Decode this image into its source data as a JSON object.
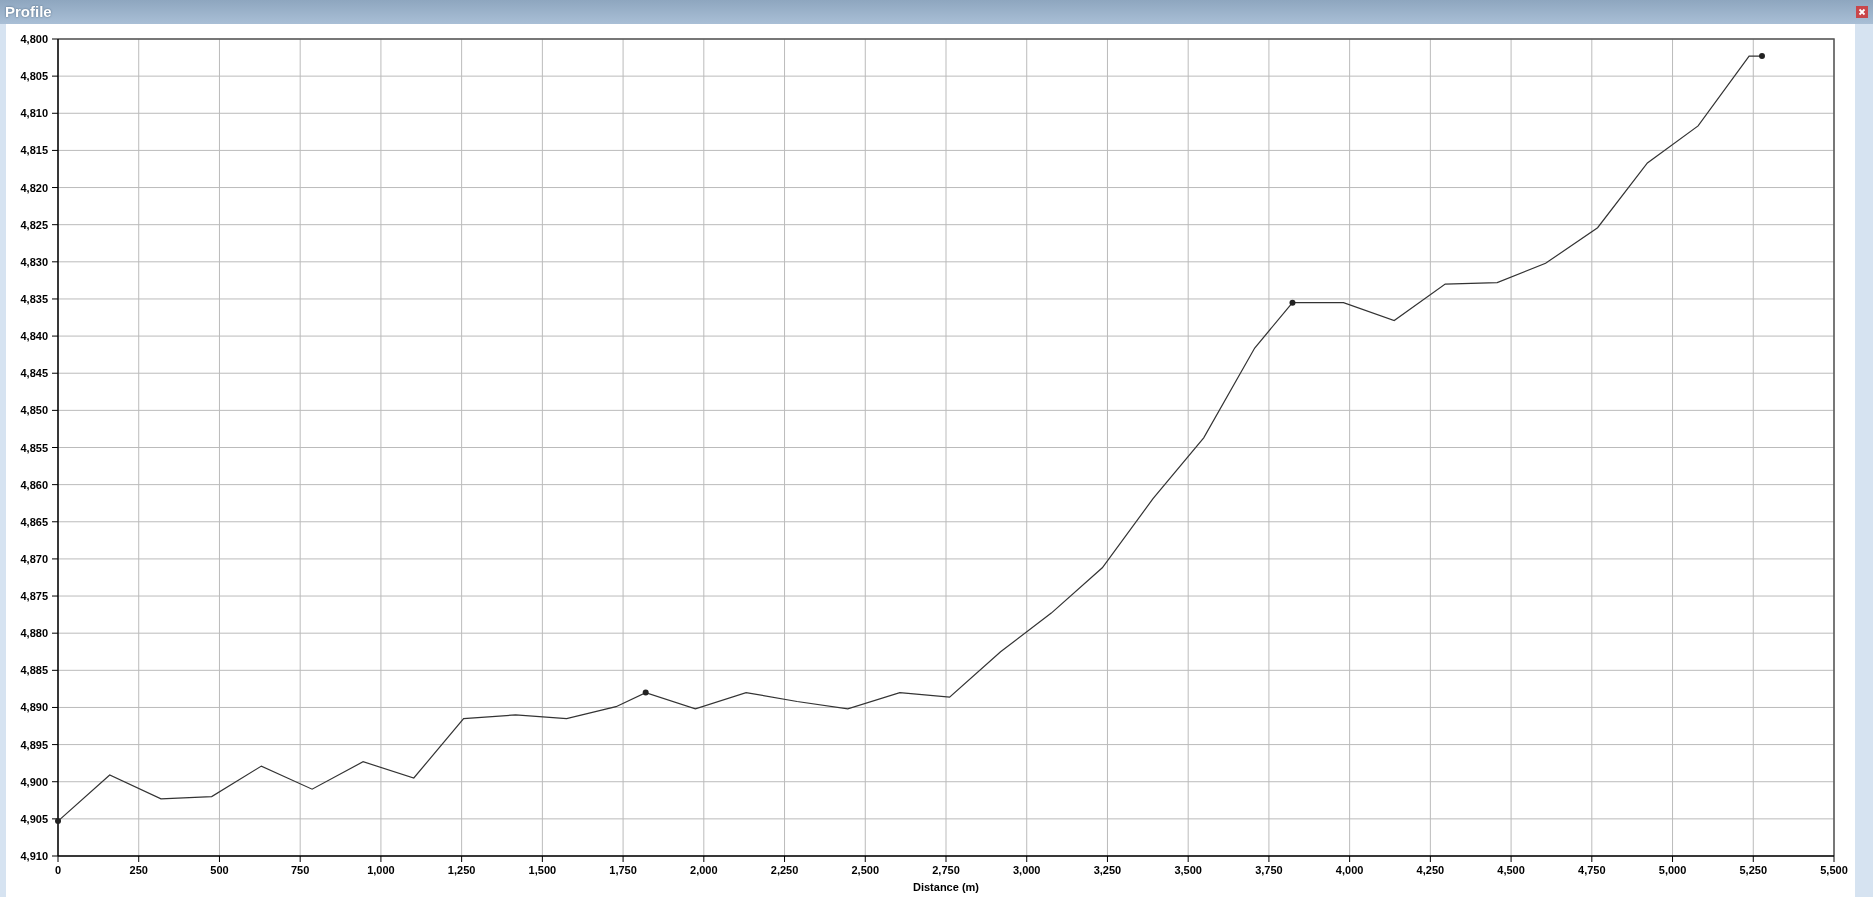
{
  "window": {
    "title": "Profile"
  },
  "chart_data": {
    "type": "line",
    "xlabel": "Distance (m)",
    "xlim": [
      0,
      5500
    ],
    "ylim": [
      4910,
      4800
    ],
    "xticks": [
      {
        "value": 0,
        "label": "0"
      },
      {
        "value": 250,
        "label": "250"
      },
      {
        "value": 500,
        "label": "500"
      },
      {
        "value": 750,
        "label": "750"
      },
      {
        "value": 1000,
        "label": "1,000"
      },
      {
        "value": 1250,
        "label": "1,250"
      },
      {
        "value": 1500,
        "label": "1,500"
      },
      {
        "value": 1750,
        "label": "1,750"
      },
      {
        "value": 2000,
        "label": "2,000"
      },
      {
        "value": 2250,
        "label": "2,250"
      },
      {
        "value": 2500,
        "label": "2,500"
      },
      {
        "value": 2750,
        "label": "2,750"
      },
      {
        "value": 3000,
        "label": "3,000"
      },
      {
        "value": 3250,
        "label": "3,250"
      },
      {
        "value": 3500,
        "label": "3,500"
      },
      {
        "value": 3750,
        "label": "3,750"
      },
      {
        "value": 4000,
        "label": "4,000"
      },
      {
        "value": 4250,
        "label": "4,250"
      },
      {
        "value": 4500,
        "label": "4,500"
      },
      {
        "value": 4750,
        "label": "4,750"
      },
      {
        "value": 5000,
        "label": "5,000"
      },
      {
        "value": 5250,
        "label": "5,250"
      },
      {
        "value": 5500,
        "label": "5,500"
      }
    ],
    "yticks": [
      {
        "value": 4800,
        "label": "4,800"
      },
      {
        "value": 4805,
        "label": "4,805"
      },
      {
        "value": 4810,
        "label": "4,810"
      },
      {
        "value": 4815,
        "label": "4,815"
      },
      {
        "value": 4820,
        "label": "4,820"
      },
      {
        "value": 4825,
        "label": "4,825"
      },
      {
        "value": 4830,
        "label": "4,830"
      },
      {
        "value": 4835,
        "label": "4,835"
      },
      {
        "value": 4840,
        "label": "4,840"
      },
      {
        "value": 4845,
        "label": "4,845"
      },
      {
        "value": 4850,
        "label": "4,850"
      },
      {
        "value": 4855,
        "label": "4,855"
      },
      {
        "value": 4860,
        "label": "4,860"
      },
      {
        "value": 4865,
        "label": "4,865"
      },
      {
        "value": 4870,
        "label": "4,870"
      },
      {
        "value": 4875,
        "label": "4,875"
      },
      {
        "value": 4880,
        "label": "4,880"
      },
      {
        "value": 4885,
        "label": "4,885"
      },
      {
        "value": 4890,
        "label": "4,890"
      },
      {
        "value": 4895,
        "label": "4,895"
      },
      {
        "value": 4900,
        "label": "4,900"
      },
      {
        "value": 4905,
        "label": "4,905"
      },
      {
        "value": 4910,
        "label": "4,910"
      }
    ],
    "grid": true,
    "x": [
      0,
      160,
      319,
      476,
      630,
      787,
      945,
      1102,
      1256,
      1417,
      1575,
      1728,
      1820,
      1974,
      2131,
      2289,
      2446,
      2607,
      2761,
      2919,
      3076,
      3234,
      3391,
      3548,
      3706,
      3823,
      3981,
      4138,
      4296,
      4457,
      4607,
      4768,
      4922,
      5079,
      5237,
      5277
    ],
    "series": [
      {
        "color": "#333333",
        "values": [
          4905.3,
          4899.1,
          4902.3,
          4902.0,
          4897.9,
          4901.0,
          4897.3,
          4899.5,
          4891.5,
          4891.0,
          4891.5,
          4889.9,
          4888.0,
          4890.2,
          4888.0,
          4889.2,
          4890.2,
          4888.0,
          4888.6,
          4882.5,
          4877.3,
          4871.2,
          4861.9,
          4853.7,
          4841.6,
          4835.5,
          4835.5,
          4837.9,
          4833.0,
          4832.8,
          4830.2,
          4825.4,
          4816.7,
          4811.7,
          4802.3,
          4802.3
        ]
      },
      {
        "color": "#222222",
        "marker": "circle",
        "values": [
          4905.3,
          null,
          null,
          null,
          null,
          null,
          null,
          null,
          null,
          null,
          null,
          null,
          null,
          null,
          null,
          null,
          null,
          null,
          null,
          null,
          null,
          null,
          null,
          null,
          null,
          null,
          null,
          null,
          null,
          null,
          null,
          null,
          null,
          null,
          null,
          null
        ]
      },
      {
        "color": "#222222",
        "marker": "circle",
        "values": [
          null,
          null,
          null,
          null,
          null,
          null,
          null,
          null,
          null,
          null,
          null,
          null,
          4888.0,
          null,
          null,
          null,
          null,
          null,
          null,
          null,
          null,
          null,
          null,
          null,
          null,
          null,
          null,
          null,
          null,
          null,
          null,
          null,
          null,
          null,
          null,
          null
        ]
      },
      {
        "color": "#222222",
        "marker": "circle",
        "values": [
          null,
          null,
          null,
          null,
          null,
          null,
          null,
          null,
          null,
          null,
          null,
          null,
          null,
          null,
          null,
          null,
          null,
          null,
          null,
          null,
          null,
          null,
          null,
          null,
          null,
          4835.5,
          null,
          null,
          null,
          null,
          null,
          null,
          null,
          null,
          null,
          null
        ]
      },
      {
        "color": "#222222",
        "marker": "circle",
        "values": [
          null,
          null,
          null,
          null,
          null,
          null,
          null,
          null,
          null,
          null,
          null,
          null,
          null,
          null,
          null,
          null,
          null,
          null,
          null,
          null,
          null,
          null,
          null,
          null,
          null,
          null,
          null,
          null,
          null,
          null,
          null,
          null,
          null,
          null,
          null,
          4802.3
        ]
      }
    ]
  }
}
